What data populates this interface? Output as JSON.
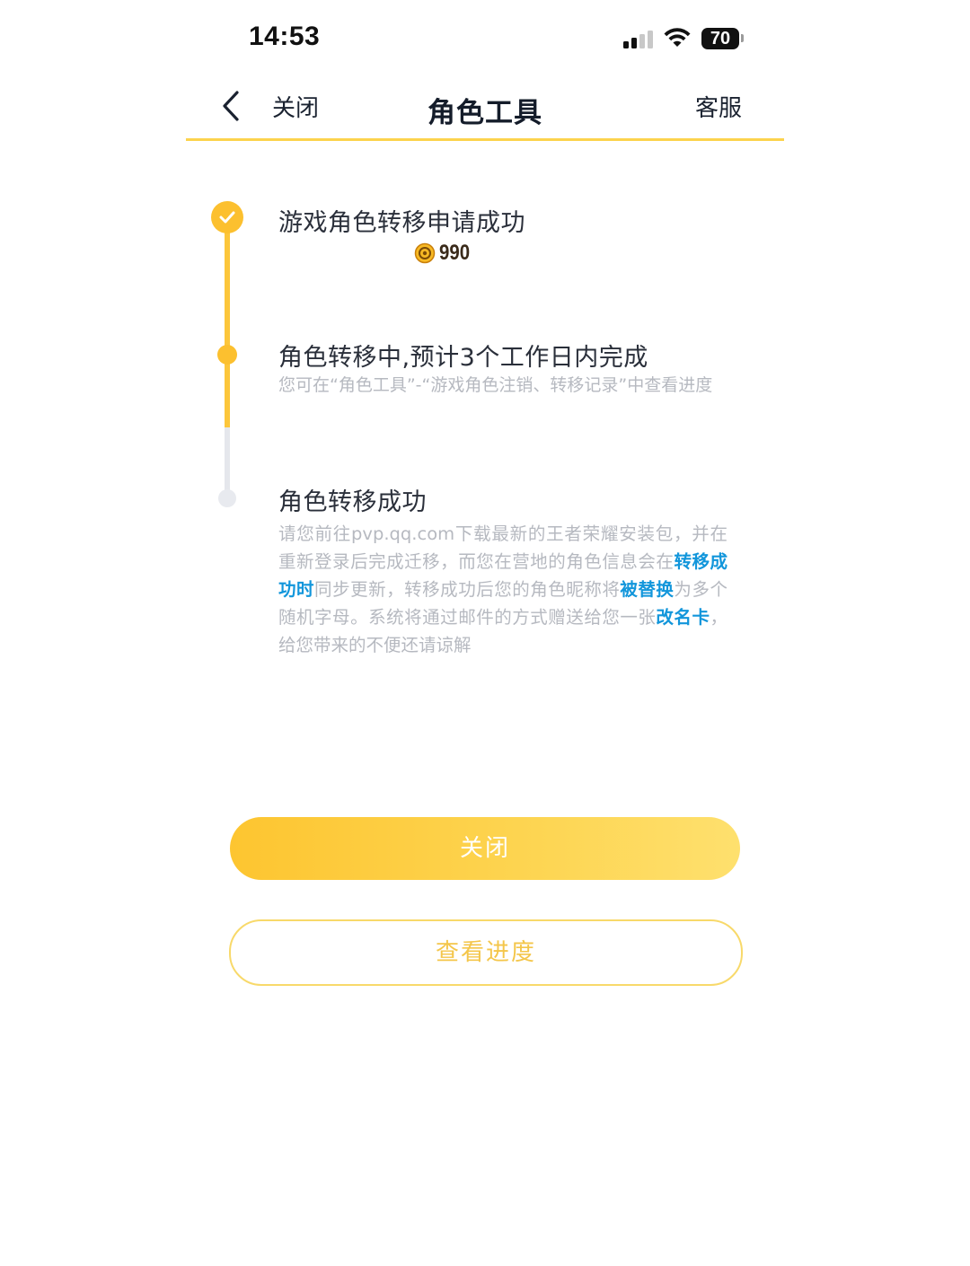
{
  "status_bar": {
    "time": "14:53",
    "battery": "70"
  },
  "nav": {
    "close_label": "关闭",
    "title": "角色工具",
    "service_label": "客服"
  },
  "steps": [
    {
      "title": "游戏角色转移申请成功",
      "coin_value": "990",
      "state": "done"
    },
    {
      "title": "角色转移中,预计3个工作日内完成",
      "description": "您可在“角色工具”-“游戏角色注销、转移记录”中查看进度",
      "state": "active"
    },
    {
      "title": "角色转移成功",
      "description_parts": [
        "请您前往pvp.qq.com下载最新的王者荣耀安装包，并在重新登录后完成迁移，而您在营地的角色信息会在",
        "转移成功时",
        "同步更新，转移成功后您的角色昵称将",
        "被替换",
        "为多个随机字母。系统将通过邮件的方式赠送给您一张",
        "改名卡",
        "，给您带来的不便还请谅解"
      ],
      "state": "pending"
    }
  ],
  "buttons": {
    "primary": "关闭",
    "secondary": "查看进度"
  },
  "colors": {
    "accent": "#fcc02f",
    "highlight": "#1296db",
    "muted_text": "#b6b9c0"
  }
}
